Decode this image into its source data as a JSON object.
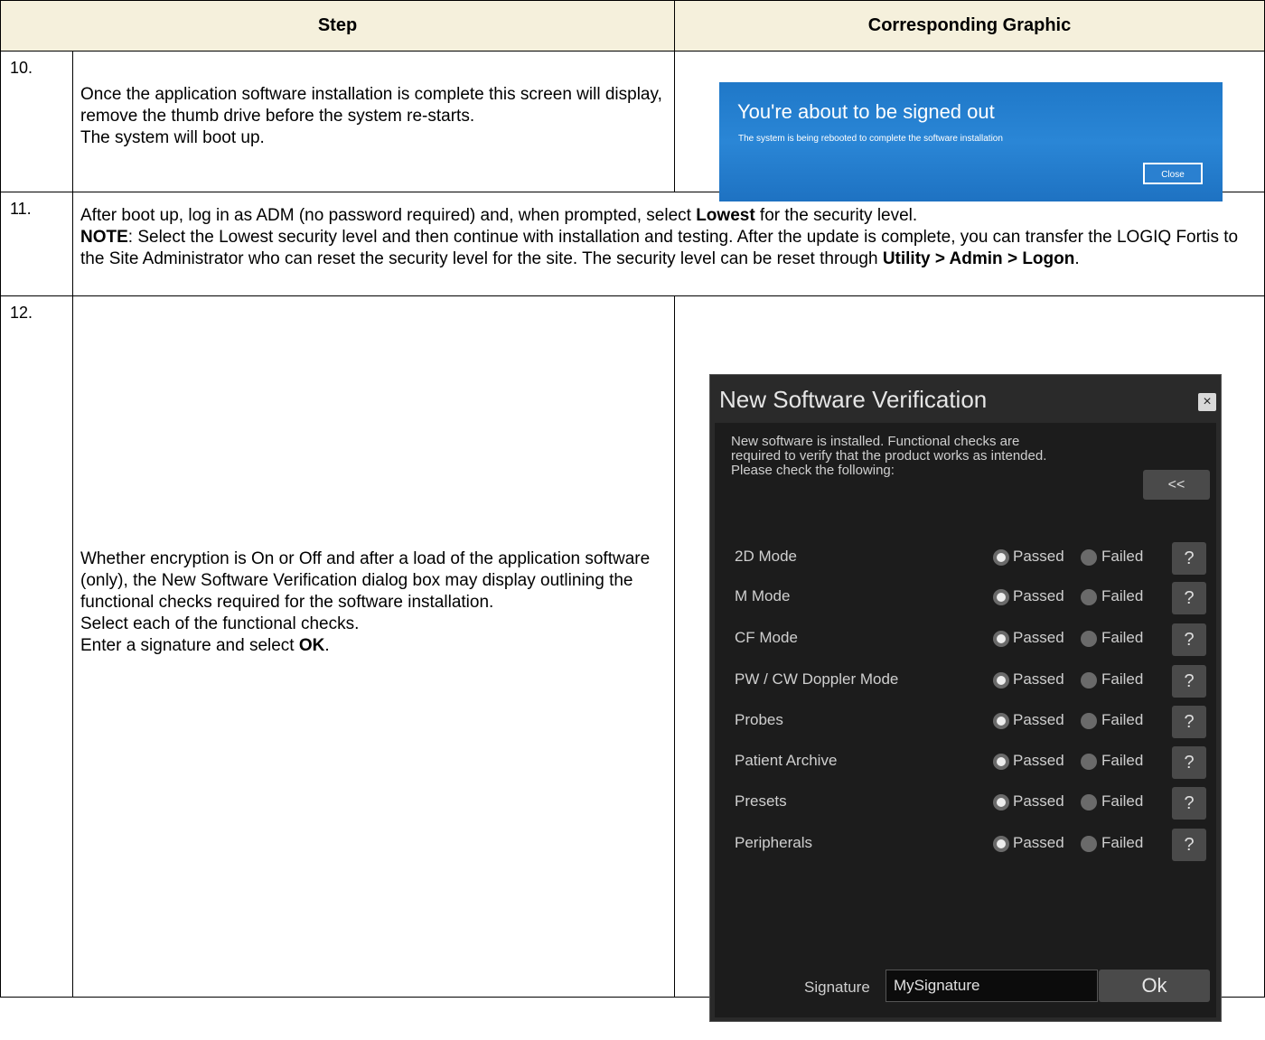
{
  "table": {
    "header": {
      "step": "Step",
      "graphic": "Corresponding Graphic"
    },
    "rows": [
      {
        "num": "10.",
        "lines": [
          "Once the application software installation is complete this screen will display, remove the thumb drive before the system re-starts.",
          "The system will boot up."
        ]
      },
      {
        "num": "11.",
        "line1_pre": "After boot up, log in as ADM (no password required) and, when prompted, select ",
        "line1_bold": "Lowest",
        "line1_post": " for the security level.",
        "note_label": "NOTE",
        "note_text": ": Select the Lowest security level and then continue with installation and testing. After the update is complete, you can transfer the LOGIQ Fortis to the Site Administrator who can reset the security level for the site. The security level can be reset through ",
        "note_path": "Utility > Admin > Logon",
        "note_end": "."
      },
      {
        "num": "12.",
        "p1": "Whether encryption is On or Off and after a load of the application software (only), the New Software Verification dialog box may display outlining the functional checks required for the software installation.",
        "p2": "Select each of the functional checks.",
        "p3_pre": "Enter a signature and select ",
        "p3_bold": "OK",
        "p3_post": "."
      }
    ]
  },
  "signout": {
    "title": "You're about to be signed out",
    "subtitle": "The system is being rebooted to complete the software installation",
    "close_label": "Close"
  },
  "dialog": {
    "title": "New Software Verification",
    "close_glyph": "×",
    "intro": [
      "New software is installed. Functional checks are",
      "required to verify that the product works as intended.",
      "Please check the following:"
    ],
    "collapse_label": "<<",
    "passed_label": "Passed",
    "failed_label": "Failed",
    "help_label": "?",
    "checks": [
      {
        "label": "2D Mode",
        "selected": "passed"
      },
      {
        "label": "M Mode",
        "selected": "passed"
      },
      {
        "label": "CF Mode",
        "selected": "passed"
      },
      {
        "label": "PW / CW Doppler Mode",
        "selected": "passed"
      },
      {
        "label": "Probes",
        "selected": "passed"
      },
      {
        "label": "Patient Archive",
        "selected": "passed"
      },
      {
        "label": "Presets",
        "selected": "passed"
      },
      {
        "label": "Peripherals",
        "selected": "passed"
      }
    ],
    "signature_label": "Signature",
    "signature_value": "MySignature",
    "ok_label": "Ok"
  }
}
